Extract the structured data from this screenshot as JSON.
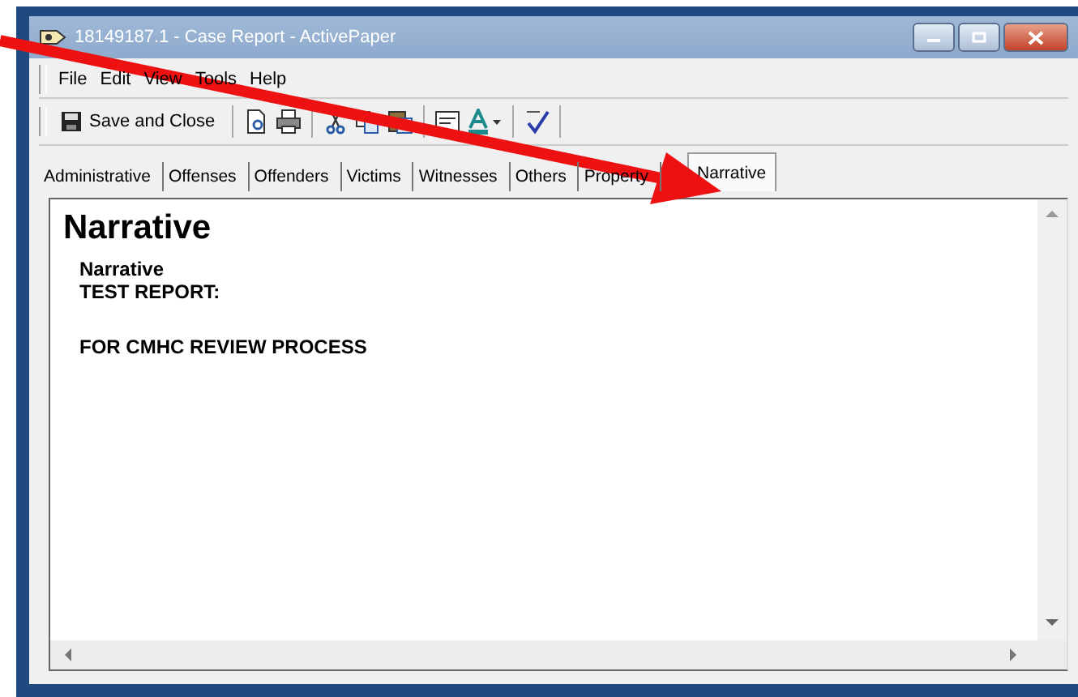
{
  "window": {
    "title": "18149187.1 - Case Report - ActivePaper"
  },
  "menu": [
    "File",
    "Edit",
    "View",
    "Tools",
    "Help"
  ],
  "toolbar": {
    "save_button": "Save and Close"
  },
  "tabs": [
    {
      "label": "Administrative",
      "selected": false
    },
    {
      "label": "Offenses",
      "selected": false
    },
    {
      "label": "Offenders",
      "selected": false
    },
    {
      "label": "Victims",
      "selected": false
    },
    {
      "label": "Witnesses",
      "selected": false
    },
    {
      "label": "Others",
      "selected": false
    },
    {
      "label": "Property",
      "selected": false
    },
    {
      "label": "Narrative",
      "selected": true
    }
  ],
  "document": {
    "heading": "Narrative",
    "subheading": "Narrative",
    "lines": [
      "TEST REPORT:",
      "FOR CMHC REVIEW PROCESS"
    ]
  }
}
